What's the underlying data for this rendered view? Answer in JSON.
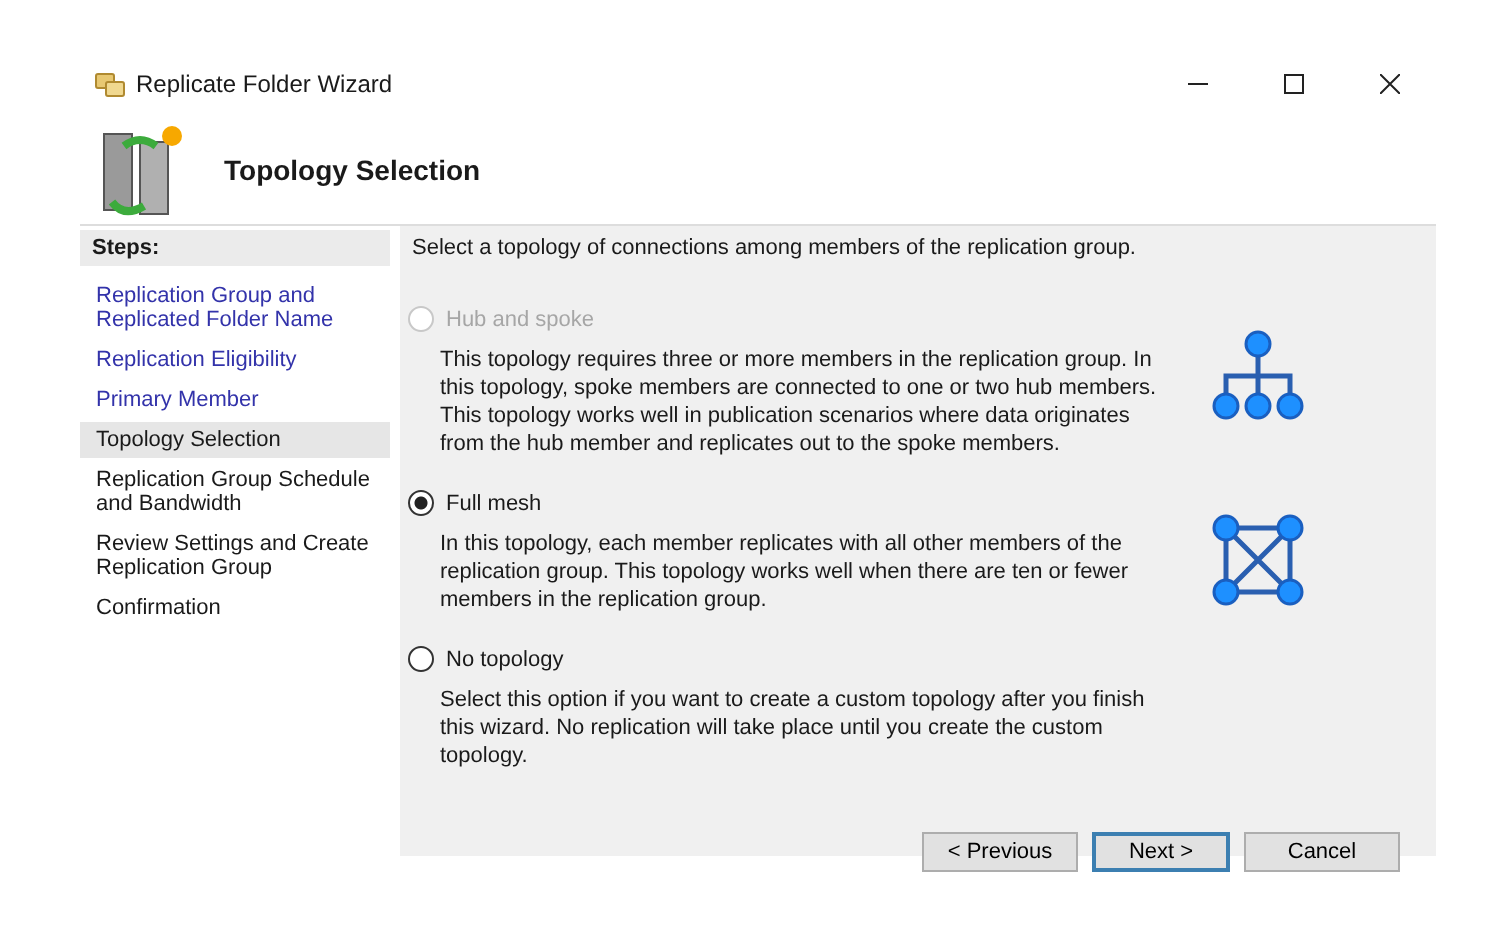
{
  "window": {
    "title": "Replicate Folder Wizard"
  },
  "header": {
    "title": "Topology Selection"
  },
  "steps": {
    "heading": "Steps:",
    "items": [
      {
        "label": "Replication Group and Replicated Folder Name",
        "completed": true,
        "selected": false
      },
      {
        "label": "Replication Eligibility",
        "completed": true,
        "selected": false
      },
      {
        "label": "Primary Member",
        "completed": true,
        "selected": false
      },
      {
        "label": "Topology Selection",
        "completed": false,
        "selected": true
      },
      {
        "label": "Replication Group Schedule and Bandwidth",
        "completed": false,
        "selected": false
      },
      {
        "label": "Review Settings and Create Replication Group",
        "completed": false,
        "selected": false
      },
      {
        "label": "Confirmation",
        "completed": false,
        "selected": false
      }
    ]
  },
  "instruction": "Select a topology of connections among members of the replication group.",
  "options": [
    {
      "label": "Hub and spoke",
      "selected": false,
      "disabled": true,
      "kind": "hub",
      "description": "This topology requires three or more members in the replication group. In this topology, spoke members are connected to one or two hub members. This topology works well in publication scenarios where data originates from the hub member and replicates out to the spoke members."
    },
    {
      "label": "Full mesh",
      "selected": true,
      "disabled": false,
      "kind": "mesh",
      "description": "In this topology, each member replicates with all other members of the replication group. This topology works well when there are ten or fewer members in the replication group."
    },
    {
      "label": "No topology",
      "selected": false,
      "disabled": false,
      "kind": "none",
      "description": "Select this option if you want to create a custom topology after you finish this wizard. No replication will take place until you create the custom topology."
    }
  ],
  "buttons": [
    {
      "label": "< Previous",
      "default": false
    },
    {
      "label": "Next >",
      "default": true
    },
    {
      "label": "Cancel",
      "default": false
    }
  ]
}
